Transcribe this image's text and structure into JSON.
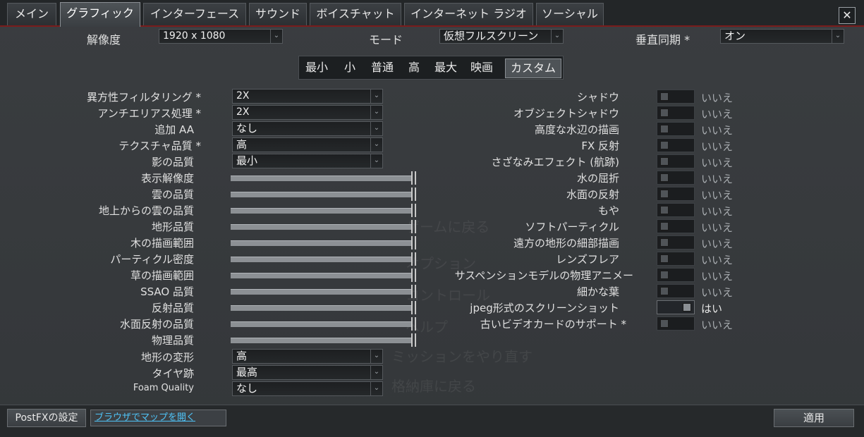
{
  "tabs": [
    "メイン",
    "グラフィック",
    "インターフェース",
    "サウンド",
    "ボイスチャット",
    "インターネット ラジオ",
    "ソーシャル"
  ],
  "close_label": "✕",
  "top": {
    "resolution_label": "解像度",
    "resolution_value": "1920 x 1080",
    "mode_label": "モード",
    "mode_value": "仮想フルスクリーン",
    "vsync_label": "垂直同期 *",
    "vsync_value": "オン"
  },
  "presets": [
    "最小",
    "小",
    "普通",
    "高",
    "最大",
    "映画",
    "カスタム"
  ],
  "left_selects": [
    {
      "label": "異方性フィルタリング *",
      "value": "2X"
    },
    {
      "label": "アンチエリアス処理 *",
      "value": "2X"
    },
    {
      "label": "追加 AA",
      "value": "なし"
    },
    {
      "label": "テクスチャ品質 *",
      "value": "高"
    },
    {
      "label": "影の品質",
      "value": "最小"
    }
  ],
  "sliders": [
    {
      "label": "表示解像度",
      "level": 1.0
    },
    {
      "label": "雲の品質",
      "level": 1.0
    },
    {
      "label": "地上からの雲の品質",
      "level": 1.0
    },
    {
      "label": "地形品質",
      "level": 1.0
    },
    {
      "label": "木の描画範囲",
      "level": 1.0
    },
    {
      "label": "パーティクル密度",
      "level": 1.0
    },
    {
      "label": "草の描画範囲",
      "level": 1.0
    },
    {
      "label": "SSAO 品質",
      "level": 1.0
    },
    {
      "label": "反射品質",
      "level": 1.0
    },
    {
      "label": "水面反射の品質",
      "level": 1.0
    },
    {
      "label": "物理品質",
      "level": 1.0
    }
  ],
  "bottom_selects": [
    {
      "label": "地形の変形",
      "value": "高"
    },
    {
      "label": "タイヤ跡",
      "value": "最高"
    },
    {
      "label": "Foam Quality",
      "value": "なし"
    }
  ],
  "toggles": [
    {
      "label": "シャドウ",
      "state": "いいえ",
      "on": false
    },
    {
      "label": "オブジェクトシャドウ",
      "state": "いいえ",
      "on": false
    },
    {
      "label": "高度な水辺の描画",
      "state": "いいえ",
      "on": false
    },
    {
      "label": "FX 反射",
      "state": "いいえ",
      "on": false
    },
    {
      "label": "さざなみエフェクト (航跡)",
      "state": "いいえ",
      "on": false
    },
    {
      "label": "水の屈折",
      "state": "いいえ",
      "on": false
    },
    {
      "label": "水面の反射",
      "state": "いいえ",
      "on": false
    },
    {
      "label": "もや",
      "state": "いいえ",
      "on": false
    },
    {
      "label": "ソフトパーティクル",
      "state": "いいえ",
      "on": false
    },
    {
      "label": "遠方の地形の細部描画",
      "state": "いいえ",
      "on": false
    },
    {
      "label": "レンズフレア",
      "state": "いいえ",
      "on": false
    },
    {
      "label": "サスペンションモデルの物理アニメー",
      "state": "いいえ",
      "on": false
    },
    {
      "label": "細かな葉",
      "state": "いいえ",
      "on": false
    },
    {
      "label": "jpeg形式のスクリーンショット",
      "state": "はい",
      "on": true
    },
    {
      "label": "古いビデオカードのサポート *",
      "state": "いいえ",
      "on": false
    }
  ],
  "ghost_menu": [
    "ゲームに戻る",
    "オプション",
    "コントロール",
    "ヘルプ",
    "ミッションをやり直す",
    "格納庫に戻る"
  ],
  "bottom": {
    "postfx_label": "PostFXの設定",
    "browser_label": "ブラウザでマップを開く",
    "apply_label": "適用"
  },
  "colors": {
    "accent_line": "#7a1c1c",
    "link": "#4fc3f7"
  }
}
